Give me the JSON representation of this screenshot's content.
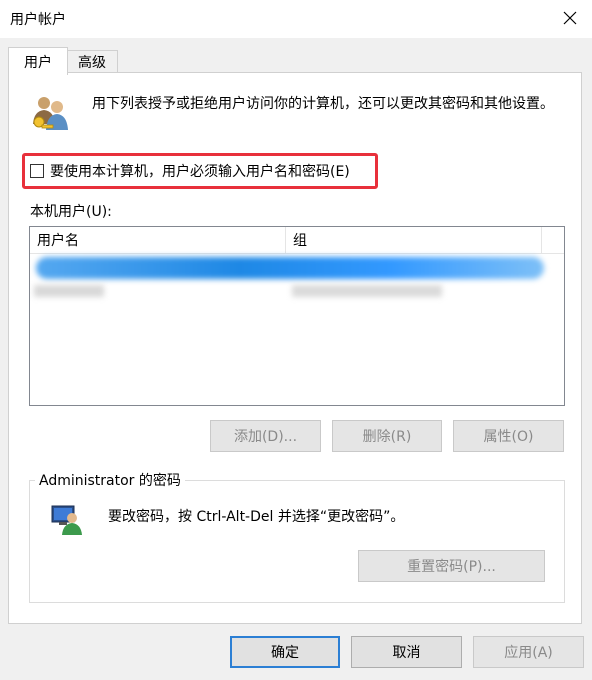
{
  "window": {
    "title": "用户帐户"
  },
  "tabs": [
    {
      "label": "用户",
      "active": true
    },
    {
      "label": "高级",
      "active": false
    }
  ],
  "intro": {
    "text": "用下列表授予或拒绝用户访问你的计算机，还可以更改其密码和其他设置。"
  },
  "require_login": {
    "label": "要使用本计算机，用户必须输入用户名和密码(E)",
    "checked": false
  },
  "users": {
    "label": "本机用户(U):",
    "columns": [
      "用户名",
      "组"
    ],
    "rows_obscured": true
  },
  "user_buttons": {
    "add": "添加(D)...",
    "remove": "删除(R)",
    "properties": "属性(O)"
  },
  "admin_password": {
    "title": "Administrator 的密码",
    "text": "要改密码，按 Ctrl-Alt-Del 并选择“更改密码”。",
    "reset_button": "重置密码(P)..."
  },
  "dialog_buttons": {
    "ok": "确定",
    "cancel": "取消",
    "apply": "应用(A)"
  },
  "colors": {
    "highlight_border": "#e8303b",
    "default_button_border": "#2c7fd4"
  }
}
